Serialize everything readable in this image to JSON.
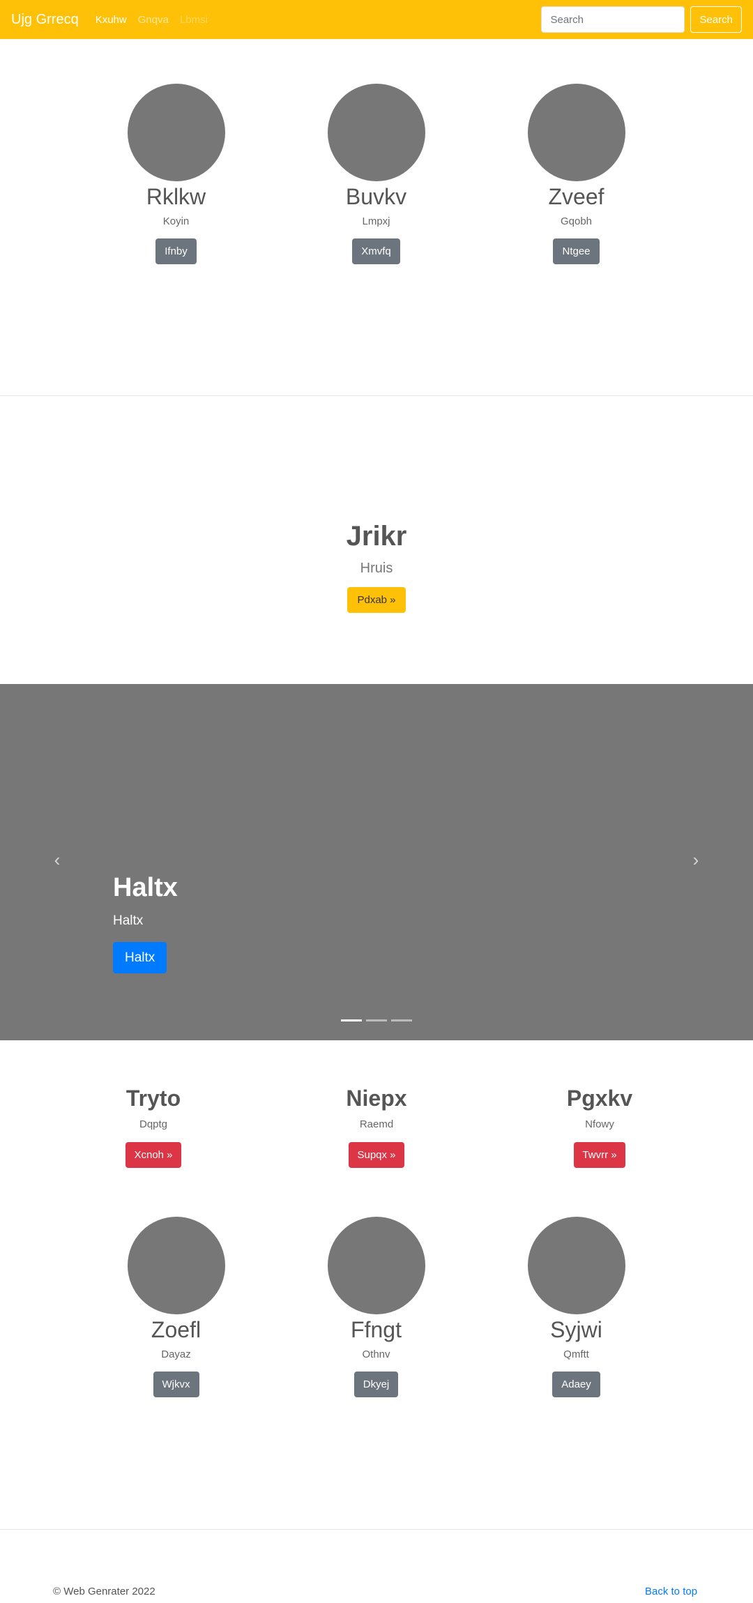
{
  "navbar": {
    "brand": "Ujg Grrecq",
    "links": [
      "Kxuhw",
      "Gnqva",
      "Lbmsi"
    ],
    "search_placeholder": "Search",
    "search_button": "Search"
  },
  "profiles_top": [
    {
      "name": "Rklkw",
      "sub": "Koyin",
      "button": "Ifnby"
    },
    {
      "name": "Buvkv",
      "sub": "Lmpxj",
      "button": "Xmvfq"
    },
    {
      "name": "Zveef",
      "sub": "Gqobh",
      "button": "Ntgee"
    }
  ],
  "jumbotron": {
    "title": "Jrikr",
    "subtitle": "Hruis",
    "button": "Pdxab »"
  },
  "carousel": {
    "title": "Haltx",
    "subtitle": "Haltx",
    "button": "Haltx",
    "slide_count": 3,
    "active_slide": 1
  },
  "marketing": [
    {
      "title": "Tryto",
      "sub": "Dqptg",
      "button": "Xcnoh »"
    },
    {
      "title": "Niepx",
      "sub": "Raemd",
      "button": "Supqx »"
    },
    {
      "title": "Pgxkv",
      "sub": "Nfowy",
      "button": "Twvrr »"
    }
  ],
  "profiles_bottom": [
    {
      "name": "Zoefl",
      "sub": "Dayaz",
      "button": "Wjkvx"
    },
    {
      "name": "Ffngt",
      "sub": "Othnv",
      "button": "Dkyej"
    },
    {
      "name": "Syjwi",
      "sub": "Qmftt",
      "button": "Adaey"
    }
  ],
  "footer": {
    "copyright": "© Web Genrater 2022",
    "back_to_top": "Back to top"
  },
  "colors": {
    "navbar": "#ffc107",
    "avatar": "#777777",
    "carousel_bg": "#777777",
    "secondary_button": "#6c757d",
    "danger_button": "#dc3545",
    "primary_button": "#007bff",
    "link": "#007bff"
  }
}
